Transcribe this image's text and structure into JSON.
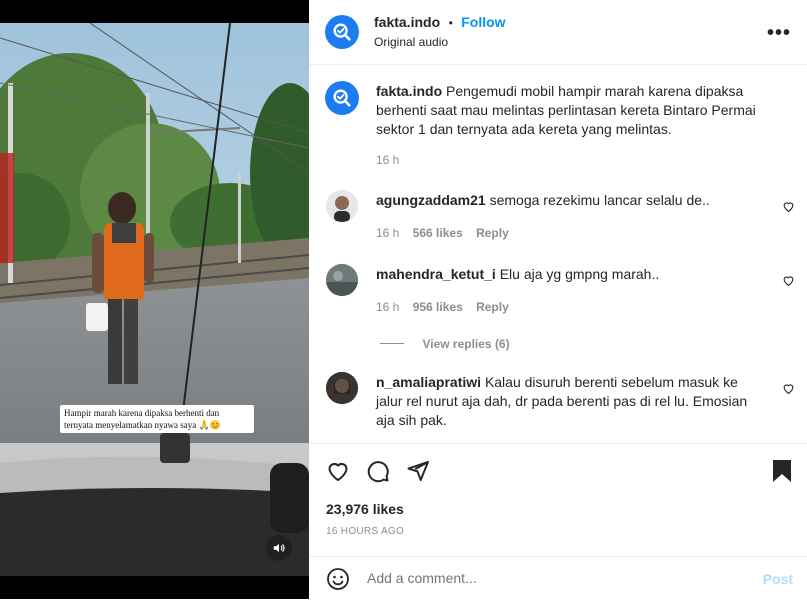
{
  "header": {
    "username": "fakta.indo",
    "separator": "•",
    "follow_label": "Follow",
    "audio_label": "Original audio",
    "more_label": "•••"
  },
  "media": {
    "caption_overlay": "Hampir marah karena dipaksa berhenti dan ternyata menyelamatkan nyawa saya 🙏😊",
    "sound_icon": "speaker-icon"
  },
  "post": {
    "username": "fakta.indo",
    "caption": "Pengemudi mobil hampir marah karena dipaksa berhenti saat mau melintas perlintasan kereta Bintaro Permai sektor 1 dan ternyata ada kereta yang melintas.",
    "time": "16 h"
  },
  "comments": [
    {
      "username": "agungzaddam21",
      "text": "semoga rezekimu lancar selalu de..",
      "time": "16 h",
      "likes": "566 likes",
      "reply": "Reply"
    },
    {
      "username": "mahendra_ketut_i",
      "text": "Elu aja yg gmpng marah..",
      "time": "16 h",
      "likes": "956 likes",
      "reply": "Reply"
    },
    {
      "username": "n_amaliapratiwi",
      "text": "Kalau disuruh berenti sebelum masuk ke jalur rel nurut aja dah, dr pada berenti pas di rel lu. Emosian aja sih pak."
    }
  ],
  "view_replies": "View replies (6)",
  "actions": {
    "likes": "23,976 likes",
    "timestamp": "16 HOURS AGO"
  },
  "add_comment": {
    "placeholder": "Add a comment...",
    "post_label": "Post"
  },
  "colors": {
    "brand_blue": "#1d7df0",
    "follow_blue": "#0095f6",
    "post_disabled": "#b3dbff"
  }
}
